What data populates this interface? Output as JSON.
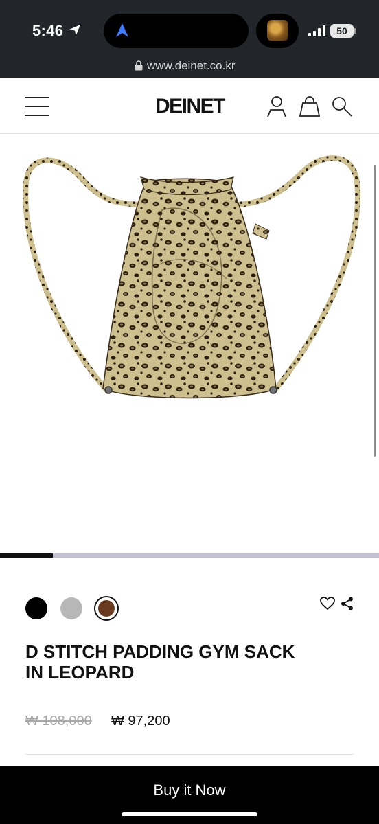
{
  "status_bar": {
    "time": "5:46",
    "battery": "50",
    "icons": [
      "location-arrow-icon",
      "navigation-icon",
      "app-thumbnail",
      "signal-icon",
      "battery-icon"
    ]
  },
  "browser": {
    "url": "www.deinet.co.kr",
    "icons": [
      "lock-icon"
    ]
  },
  "header": {
    "logo": "DEINET",
    "icons": [
      "menu-icon",
      "user-icon",
      "bag-icon",
      "search-icon"
    ]
  },
  "gallery": {
    "image_subject": "leopard print drawstring gym sack",
    "slide_progress": 0.14
  },
  "product": {
    "color_options": [
      {
        "name": "black",
        "color": "#000000"
      },
      {
        "name": "grey",
        "color": "#b7b7b7"
      },
      {
        "name": "brown",
        "color": "#6a3a1f",
        "selected": true
      }
    ],
    "title": "D STITCH PADDING GYM SACK IN LEOPARD",
    "original_price": "₩ 108,000",
    "sale_price": "₩ 97,200",
    "action_icons": [
      "heart-icon",
      "share-icon"
    ]
  },
  "cta": {
    "buy_label": "Buy it Now"
  },
  "colors": {
    "status_bg": "#22262b",
    "accent": "#000000",
    "slider_track": "#c3c1d3"
  }
}
